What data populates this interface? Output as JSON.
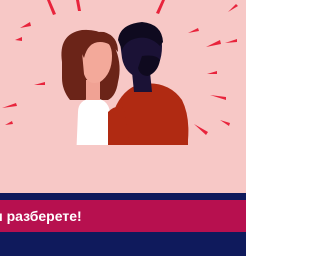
{
  "hero": {
    "illustration": "two-people-illustration",
    "background_color": "#f7c8c6",
    "accent_color": "#e8243c"
  },
  "cta": {
    "text": "ест и разберете!",
    "background_color": "#b7104f"
  },
  "footer": {
    "background_color": "#0f1a5c"
  }
}
